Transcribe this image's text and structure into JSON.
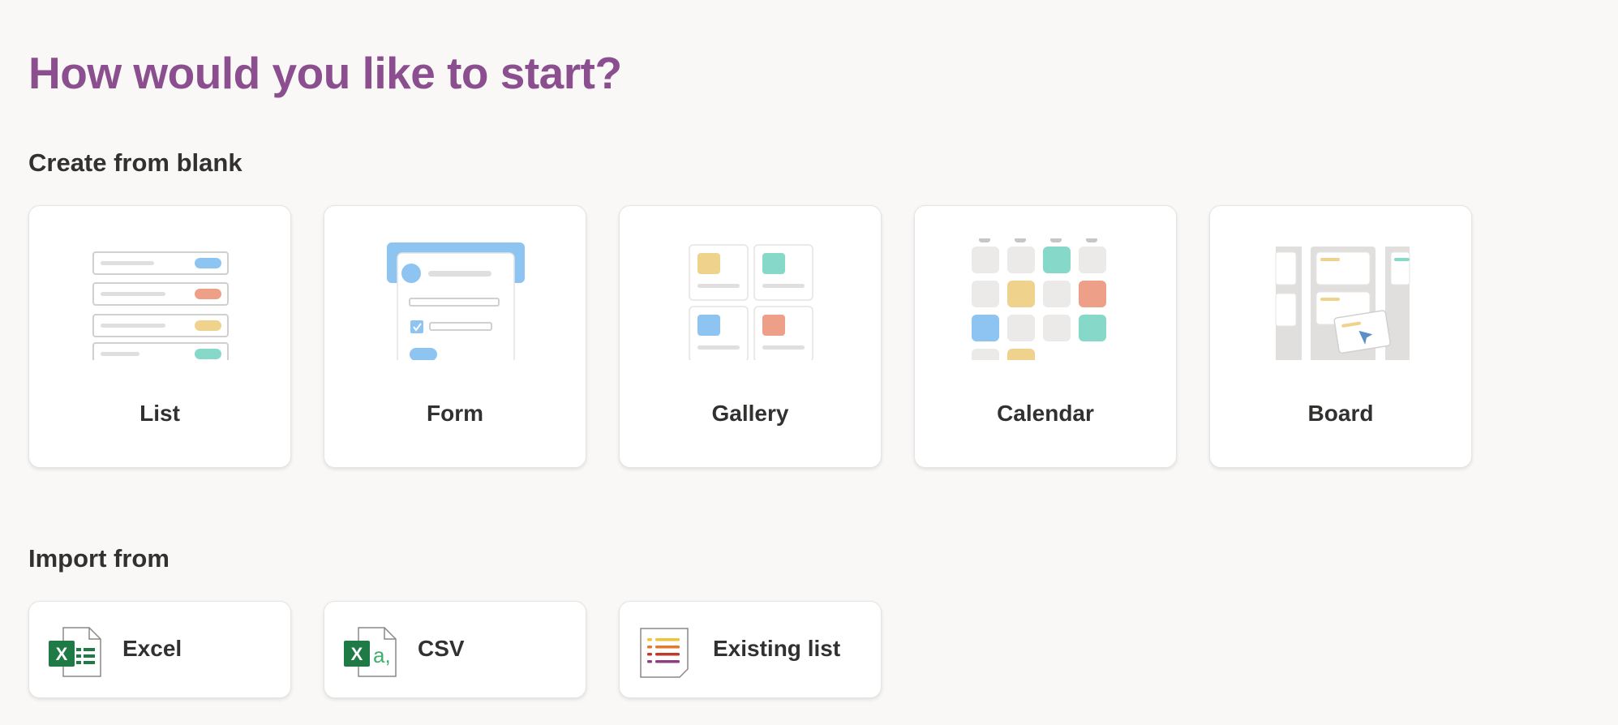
{
  "page": {
    "title": "How would you like to start?",
    "title_color": "#8b4f8f"
  },
  "create_section": {
    "heading": "Create from blank",
    "options": [
      {
        "label": "List",
        "icon": "list-illustration"
      },
      {
        "label": "Form",
        "icon": "form-illustration"
      },
      {
        "label": "Gallery",
        "icon": "gallery-illustration"
      },
      {
        "label": "Calendar",
        "icon": "calendar-illustration"
      },
      {
        "label": "Board",
        "icon": "board-illustration"
      }
    ]
  },
  "import_section": {
    "heading": "Import from",
    "options": [
      {
        "label": "Excel",
        "icon": "excel-file-icon"
      },
      {
        "label": "CSV",
        "icon": "csv-file-icon"
      },
      {
        "label": "Existing list",
        "icon": "existing-list-icon"
      }
    ]
  },
  "colors": {
    "blue": "#8ec4f2",
    "orange": "#ee9f87",
    "yellow": "#efd38c",
    "teal": "#86d9c8",
    "excel_green": "#1f7a45"
  }
}
